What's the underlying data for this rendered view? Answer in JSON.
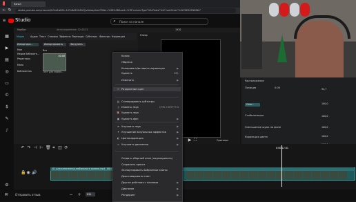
{
  "browser": {
    "url": "studio.youtube.com/channel/UCezEwNOn-1K7n8AZXUAIVQ/videos/short?filter=%5B%5D&sort=%7B\"columnType\"%3A\"date\"%2C\"sortOrder\"%3A\"DESCENDING\"",
    "tab_title": "Канал"
  },
  "yt": {
    "logo": "Studio",
    "search_placeholder": "Поиск на канале"
  },
  "editor": {
    "app_title": "Карбон",
    "saved_status": "Автосохранение: 12:43:22",
    "top_tabs": [
      "Медиа",
      "Аудио",
      "Текст",
      "Стикеры",
      "Эффекты",
      "Переходы",
      "Субтитры",
      "Фильтры",
      "Коррекция"
    ],
    "media_left_items": [
      "Импортиро...",
      "Мое",
      "Медиа библиоте...",
      "Редакторы",
      "Моно",
      "Библиотека"
    ],
    "import_label": "Импортировать",
    "extra_label": "Загрузить",
    "all_label": "Все",
    "thumb_caption": "Тест для мобил...",
    "thumb_duration": "00:08",
    "player_label": "Плеер",
    "timecode_top": "1920",
    "timecode_right": "0:00:12:01",
    "aspect_label": "Оригинал",
    "props_title": "Расположение",
    "props_row_position": "Позиция",
    "props_pos_value": "0:00",
    "props_rows": [
      "Стабилизация",
      "Уменьшение шума на фоне",
      "Коррекция цвета"
    ],
    "props_color_chip": "Color...",
    "props_values": [
      "94,7",
      "100,0",
      "100,0",
      "100,0",
      "100,0",
      "100,0"
    ],
    "track_title": "01 для кинотеатра-мобильного канала.mp4",
    "track_duration": "00:00:28:01",
    "bottom_left": "Отправить отзыв",
    "zoom_value": "834"
  },
  "context_menu": {
    "items": [
      {
        "label": "Копия",
        "icon": "",
        "shortcut": ""
      },
      {
        "label": "Обрезка",
        "icon": "",
        "shortcut": ""
      },
      {
        "label": "Копировать/вставить параметры",
        "icon": "",
        "shortcut": "▶"
      },
      {
        "label": "Удалить",
        "icon": "",
        "shortcut": "DEL"
      },
      {
        "label": "Изменить",
        "icon": "",
        "shortcut": "▶"
      },
      {
        "label": "Разделение сцен",
        "icon": "✂",
        "shortcut": ""
      },
      {
        "label": "Сгенерировать субтитры",
        "icon": "▤",
        "shortcut": ""
      },
      {
        "label": "Извлечь звук",
        "icon": "♫",
        "shortcut": "CTRL+SHIFT+D"
      },
      {
        "label": "Удалить звук",
        "icon": "🔇",
        "shortcut": ""
      },
      {
        "label": "Удалить фон",
        "icon": "▣",
        "shortcut": "▶"
      },
      {
        "label": "Улучшить звук",
        "icon": "≋",
        "shortcut": "▶"
      },
      {
        "label": "Улучшение визуальных эффектов",
        "icon": "✦",
        "shortcut": "▶"
      },
      {
        "label": "Цветокоррекция",
        "icon": "◐",
        "shortcut": "▶"
      },
      {
        "label": "Улучшить движения",
        "icon": "≈",
        "shortcut": "▶"
      },
      {
        "label": "Создать сборный клип (подсоединить)",
        "icon": "",
        "shortcut": ""
      },
      {
        "label": "Сохранить пресет",
        "icon": "",
        "shortcut": ""
      },
      {
        "label": "Экспортировать выбранные клипы",
        "icon": "",
        "shortcut": ""
      },
      {
        "label": "Деактивировать клип",
        "icon": "",
        "shortcut": ""
      },
      {
        "label": "Другие действия с клипами",
        "icon": "",
        "shortcut": "▶"
      },
      {
        "label": "Диапазон",
        "icon": "",
        "shortcut": "▶"
      },
      {
        "label": "Рендеринг",
        "icon": "",
        "shortcut": "▶"
      }
    ],
    "hover_index": 5
  },
  "colors": {
    "accent_teal": "#1d5a5c",
    "brand_red": "#ff0000",
    "menu_bg": "#2a2a2c"
  }
}
